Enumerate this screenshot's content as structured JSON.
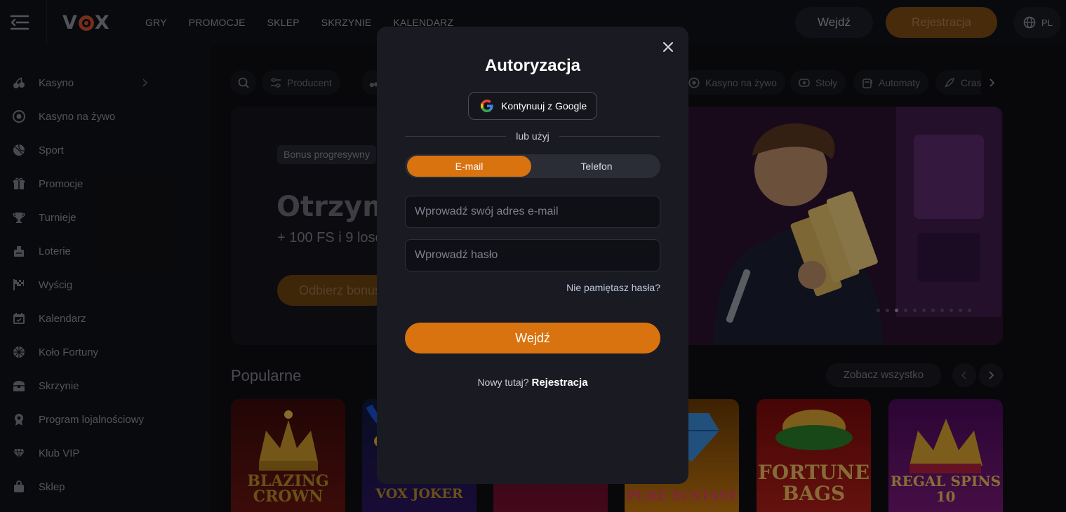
{
  "header": {
    "nav": [
      "GRY",
      "PROMOCJE",
      "SKLEP",
      "SKRZYNIE",
      "KALENDARZ"
    ],
    "login_label": "Wejdź",
    "register_label": "Rejestracja",
    "language": "PL"
  },
  "sidebar": {
    "items": [
      {
        "label": "Kasyno",
        "icon": "cherries-icon"
      },
      {
        "label": "Kasyno na żywo",
        "icon": "chip-icon"
      },
      {
        "label": "Sport",
        "icon": "ball-icon"
      },
      {
        "label": "Promocje",
        "icon": "gift-icon"
      },
      {
        "label": "Turnieje",
        "icon": "trophy-icon"
      },
      {
        "label": "Loterie",
        "icon": "lottery-icon"
      },
      {
        "label": "Wyścig",
        "icon": "flag-icon"
      },
      {
        "label": "Kalendarz",
        "icon": "calendar-icon"
      },
      {
        "label": "Koło Fortuny",
        "icon": "wheel-icon"
      },
      {
        "label": "Skrzynie",
        "icon": "chest-icon"
      },
      {
        "label": "Program lojalnościowy",
        "icon": "loyalty-icon"
      },
      {
        "label": "Klub VIP",
        "icon": "diamond-icon"
      },
      {
        "label": "Sklep",
        "icon": "bag-icon"
      }
    ]
  },
  "filters": {
    "producer": "Producent",
    "live_casino": "Kasyno na żywo",
    "tables": "Stoły",
    "slots": "Automaty",
    "crash": "Cras"
  },
  "banner": {
    "badge": "Bonus progresywny",
    "title": "Otrzym",
    "subtitle": "+ 100 FS i 9 losó",
    "cta": "Odbierz bonus",
    "slides_total": 11,
    "active_slide": 3
  },
  "popular": {
    "title": "Popularne",
    "see_all": "Zobacz wszystko",
    "games": [
      "BLAZING CROWN",
      "VOX JOKER",
      "",
      "PURE ECSTASY",
      "FORTUNE BAGS",
      "REGAL SPINS 10"
    ]
  },
  "modal": {
    "title": "Autoryzacja",
    "google_label": "Kontynuuj z Google",
    "divider": "lub użyj",
    "tab_email": "E-mail",
    "tab_phone": "Telefon",
    "email_placeholder": "Wprowadź swój adres e-mail",
    "password_placeholder": "Wprowadź hasło",
    "forgot": "Nie pamiętasz hasła?",
    "submit": "Wejdź",
    "new_here": "Nowy tutaj?",
    "register_link": "Rejestracja"
  },
  "colors": {
    "accent": "#d9730f",
    "modal_bg": "#1a1b22",
    "page_bg": "#0e0f14"
  }
}
